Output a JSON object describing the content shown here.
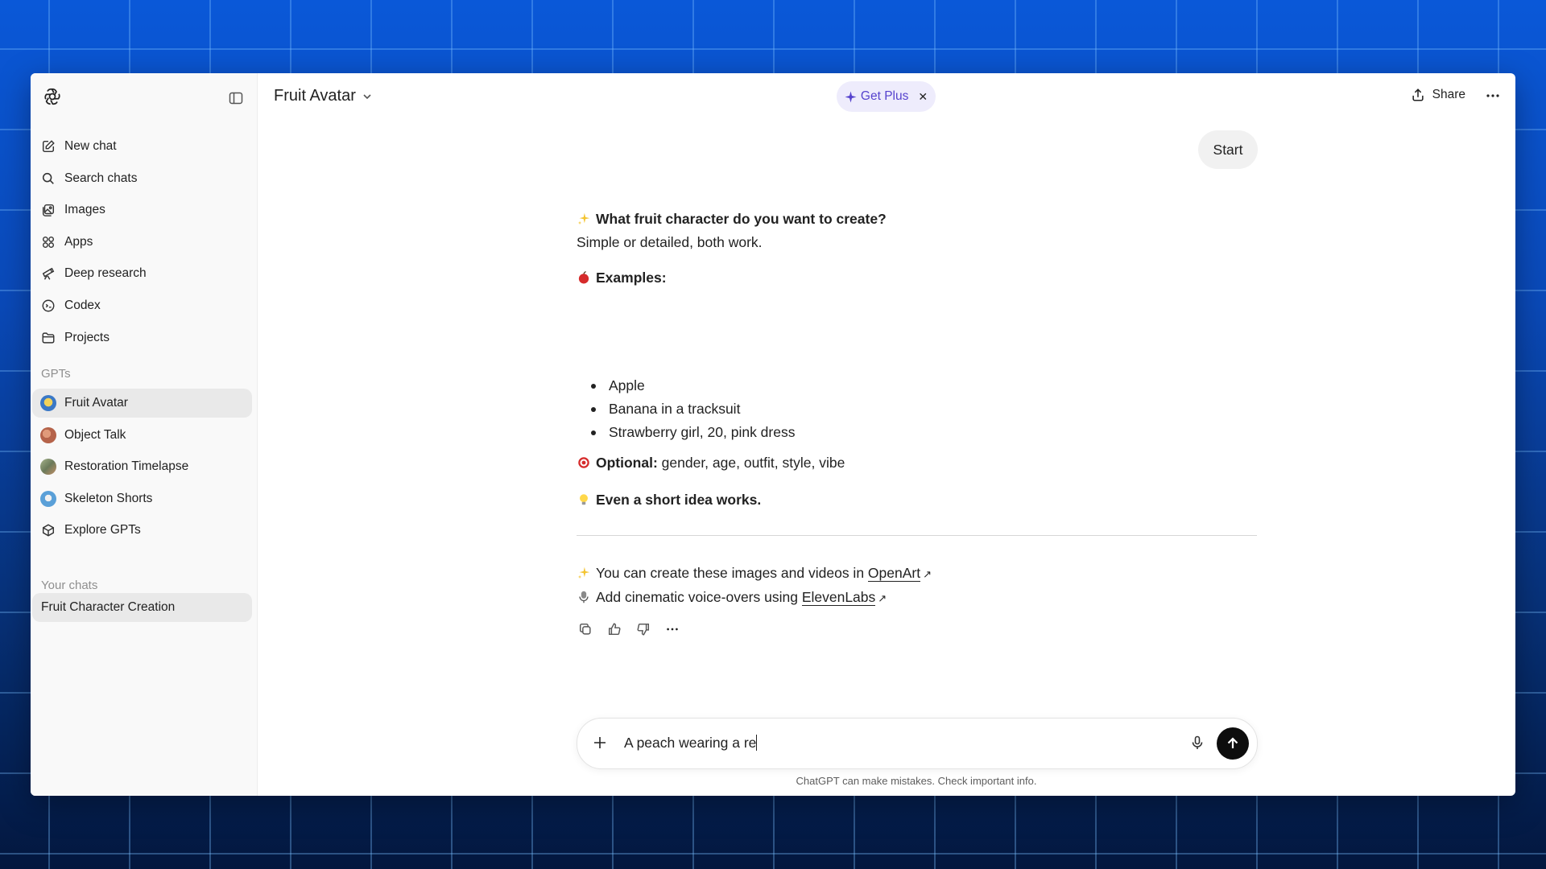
{
  "sidebar": {
    "nav": [
      {
        "label": "New chat",
        "icon": "edit-icon"
      },
      {
        "label": "Search chats",
        "icon": "search-icon"
      },
      {
        "label": "Images",
        "icon": "images-icon"
      },
      {
        "label": "Apps",
        "icon": "apps-icon"
      },
      {
        "label": "Deep research",
        "icon": "telescope-icon"
      },
      {
        "label": "Codex",
        "icon": "codex-icon"
      },
      {
        "label": "Projects",
        "icon": "folder-icon"
      }
    ],
    "gpts_label": "GPTs",
    "gpts": [
      {
        "label": "Fruit Avatar",
        "color": "#3a78c6"
      },
      {
        "label": "Object Talk",
        "color": "#b5634a"
      },
      {
        "label": "Restoration Timelapse",
        "color": "#7a8a6a"
      },
      {
        "label": "Skeleton Shorts",
        "color": "#5aa0d8"
      },
      {
        "label": "Explore GPTs",
        "icon": "cube-icon"
      }
    ],
    "chats_label": "Your chats",
    "chats": [
      {
        "label": "Fruit Character Creation"
      }
    ]
  },
  "header": {
    "model": "Fruit Avatar",
    "get_plus": "Get Plus",
    "share": "Share"
  },
  "conversation": {
    "user_message": "Start",
    "q_title": "What fruit character do you want to create?",
    "q_sub": "Simple or detailed, both work.",
    "examples_title": "Examples:",
    "examples": [
      "Apple",
      "Banana in a tracksuit",
      "Strawberry girl, 20, pink dress"
    ],
    "optional_label": "Optional:",
    "optional_text": " gender, age, outfit, style, vibe",
    "short_idea": "Even a short idea works.",
    "promo1_text": "You can create these images and videos in ",
    "promo1_link": "OpenArt",
    "promo2_text": "Add cinematic voice-overs using ",
    "promo2_link": "ElevenLabs"
  },
  "composer": {
    "value": "A peach wearing a re",
    "disclaimer": "ChatGPT can make mistakes. Check important info."
  }
}
